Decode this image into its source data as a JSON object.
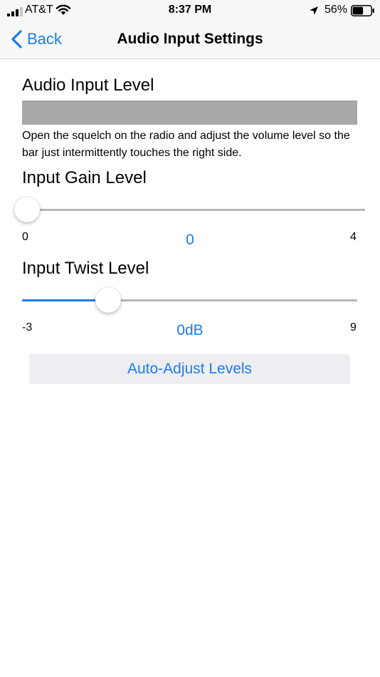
{
  "status_bar": {
    "carrier": "AT&T",
    "time": "8:37 PM",
    "battery_percent": "56%",
    "icons": [
      "signal-icon",
      "wifi-icon",
      "location-arrow-icon",
      "battery-icon"
    ]
  },
  "nav": {
    "back_label": "Back",
    "title": "Audio Input Settings",
    "accent_color": "#1a7cf0"
  },
  "audio_input": {
    "title": "Audio Input Level",
    "instructions": "Open the squelch on the radio and adjust the volume level so the bar just intermittently touches the right side.",
    "bar_color": "#a8a8a8"
  },
  "gain": {
    "title": "Input Gain Level",
    "min_label": "0",
    "max_label": "4",
    "value_label": "0",
    "value": 0,
    "min": 0,
    "max": 4
  },
  "twist": {
    "title": "Input Twist Level",
    "min_label": "-3",
    "max_label": "9",
    "value_label": "0dB",
    "value": 0,
    "min": -3,
    "max": 9
  },
  "auto_button_label": "Auto-Adjust Levels"
}
